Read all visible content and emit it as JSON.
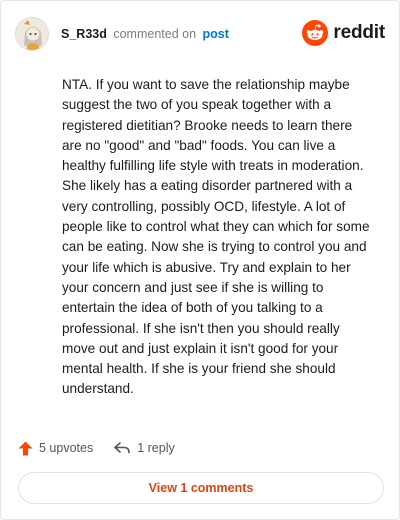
{
  "header": {
    "username": "S_R33d",
    "action_text": "commented on",
    "post_link": "post",
    "brand_name": "reddit"
  },
  "comment": {
    "text": "NTA. If you want to save the relationship maybe suggest the two of you speak together with a registered dietitian? Brooke needs to learn there are no \"good\" and \"bad\" foods. You can live a healthy fulfilling life style with treats in moderation. She likely has a eating disorder partnered with a very controlling, possibly OCD, lifestyle. A lot of people like to control what they can which for some can be eating. Now she is trying to control you and your life which is abusive. Try and explain to her your concern and just see if she is willing to entertain the idea of both of you talking to a professional. If she isn't then you should really move out and just explain it isn't good for your mental health. If she is your friend she should understand."
  },
  "actions": {
    "upvotes_label": "5 upvotes",
    "reply_label": "1 reply"
  },
  "footer": {
    "view_comments_label": "View 1 comments"
  },
  "colors": {
    "brand_orange": "#ff4500",
    "link_blue": "#0079d3",
    "view_button_text": "#d2461e"
  },
  "icons": {
    "avatar": "avatar-icon",
    "logo": "reddit-logo-icon",
    "upvote": "upvote-arrow-icon",
    "reply": "reply-arrow-icon"
  }
}
